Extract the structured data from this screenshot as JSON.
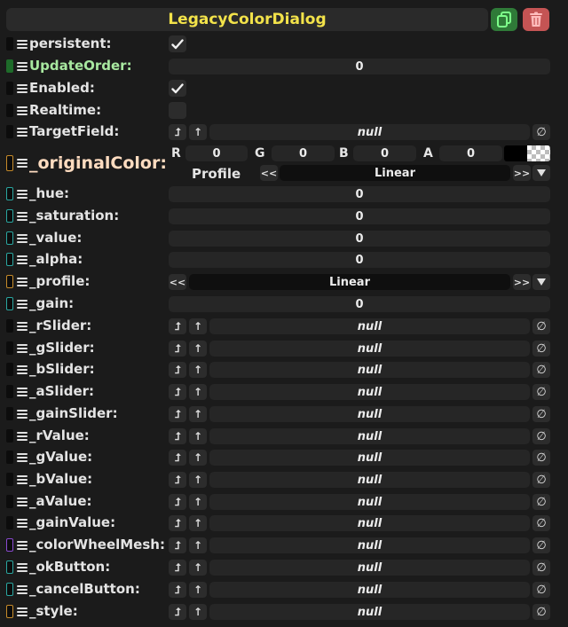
{
  "header": {
    "title": "LegacyColorDialog",
    "duplicate_icon": "copy-icon",
    "delete_icon": "trash-icon",
    "duplicate_color": "#2f7a38",
    "delete_color": "#c45454"
  },
  "fields": {
    "persistent": {
      "label": "persistent:",
      "checked": true
    },
    "updateOrder": {
      "label": "UpdateOrder:",
      "value": "0"
    },
    "enabled": {
      "label": "Enabled:",
      "checked": true
    },
    "realtime": {
      "label": "Realtime:",
      "checked": false
    },
    "targetField": {
      "label": "TargetField:",
      "value": "null"
    },
    "originalColor": {
      "label": "_originalColor:",
      "r_label": "R",
      "r": "0",
      "g_label": "G",
      "g": "0",
      "b_label": "B",
      "b": "0",
      "a_label": "A",
      "a": "0",
      "profile_label": "Profile",
      "profile": "Linear",
      "prev": "<<",
      "next": ">>"
    },
    "hue": {
      "label": "_hue:",
      "value": "0"
    },
    "saturation": {
      "label": "_saturation:",
      "value": "0"
    },
    "value": {
      "label": "_value:",
      "value": "0"
    },
    "alpha": {
      "label": "_alpha:",
      "value": "0"
    },
    "profile": {
      "label": "_profile:",
      "value": "Linear",
      "prev": "<<",
      "next": ">>"
    },
    "gain": {
      "label": "_gain:",
      "value": "0"
    },
    "rSlider": {
      "label": "_rSlider:",
      "value": "null"
    },
    "gSlider": {
      "label": "_gSlider:",
      "value": "null"
    },
    "bSlider": {
      "label": "_bSlider:",
      "value": "null"
    },
    "aSlider": {
      "label": "_aSlider:",
      "value": "null"
    },
    "gainSlider": {
      "label": "_gainSlider:",
      "value": "null"
    },
    "rValue": {
      "label": "_rValue:",
      "value": "null"
    },
    "gValue": {
      "label": "_gValue:",
      "value": "null"
    },
    "bValue": {
      "label": "_bValue:",
      "value": "null"
    },
    "aValue": {
      "label": "_aValue:",
      "value": "null"
    },
    "gainValue": {
      "label": "_gainValue:",
      "value": "null"
    },
    "colorWheelMesh": {
      "label": "_colorWheelMesh:",
      "value": "null"
    },
    "okButton": {
      "label": "_okButton:",
      "value": "null"
    },
    "cancelButton": {
      "label": "_cancelButton:",
      "value": "null"
    },
    "style": {
      "label": "_style:",
      "value": "null"
    }
  },
  "buttons": {
    "jump": "⮥",
    "up": "↑",
    "clear": "∅"
  },
  "chip_colors": {
    "black": "#0c0c0c",
    "green": "#1e6b2a",
    "orange": "#c58a2a",
    "teal": "#2aa6a0",
    "purple": "#8a4ad0"
  }
}
